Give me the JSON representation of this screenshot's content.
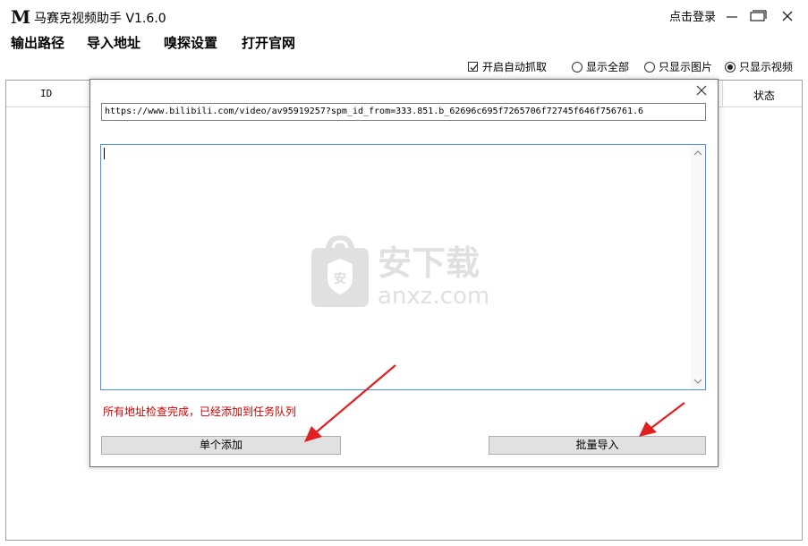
{
  "app": {
    "logo": "M",
    "title": "马赛克视频助手 V1.6.0"
  },
  "header": {
    "login_label": "点击登录"
  },
  "menu": {
    "items": [
      "输出路径",
      "导入地址",
      "嗅探设置",
      "打开官网"
    ]
  },
  "options": {
    "auto_capture": {
      "label": "开启自动抓取",
      "checked": true
    },
    "radios": [
      {
        "label": "显示全部",
        "selected": false
      },
      {
        "label": "只显示图片",
        "selected": false
      },
      {
        "label": "只显示视频",
        "selected": true
      }
    ]
  },
  "table": {
    "columns": {
      "id": "ID",
      "status": "状态"
    }
  },
  "dialog": {
    "url_value": "https://www.bilibili.com/video/av95919257?spm_id_from=333.851.b_62696c695f7265706f72745f646f756761.6",
    "status_message": "所有地址检查完成，已经添加到任务队列",
    "add_single_label": "单个添加",
    "batch_import_label": "批量导入"
  },
  "watermark": {
    "text": "安下载",
    "domain": "anxz.com"
  },
  "colors": {
    "status_text": "#cc0000",
    "arrow": "#e02020",
    "focus_border": "#4a90d9"
  }
}
